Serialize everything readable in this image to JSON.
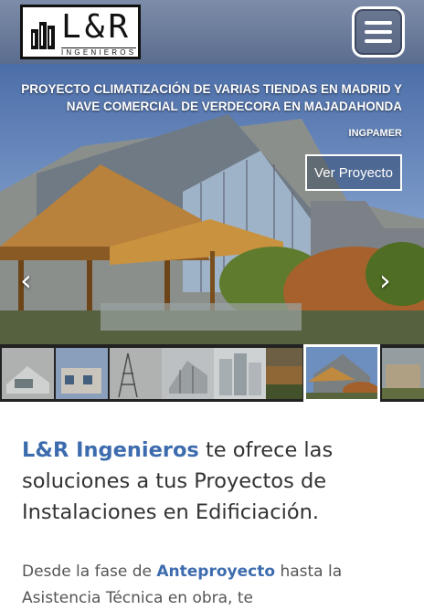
{
  "header": {
    "logo_text": "L&R",
    "logo_subtitle": "INGENIEROS",
    "menu_icon": "hamburger-menu-icon"
  },
  "slider": {
    "title": "PROYECTO CLIMATIZACIÓN DE VARIAS TIENDAS EN MADRID Y NAVE COMERCIAL DE VERDECORA EN MAJADAHONDA",
    "client": "INGPAMER",
    "cta_label": "Ver Proyecto",
    "prev_icon": "‹",
    "next_icon": "›"
  },
  "intro": {
    "brand": "L&R Ingenieros",
    "text": " te ofrece las soluciones a tus Proyectos de Instalaciones en Edificiación."
  },
  "description": {
    "part1": "Desde la fase de ",
    "highlight": "Anteproyecto",
    "part2": " hasta la Asistencia Técnica en obra, te"
  },
  "colors": {
    "brand_blue": "#3d6cae",
    "header_bg": "#6a7b9b"
  }
}
